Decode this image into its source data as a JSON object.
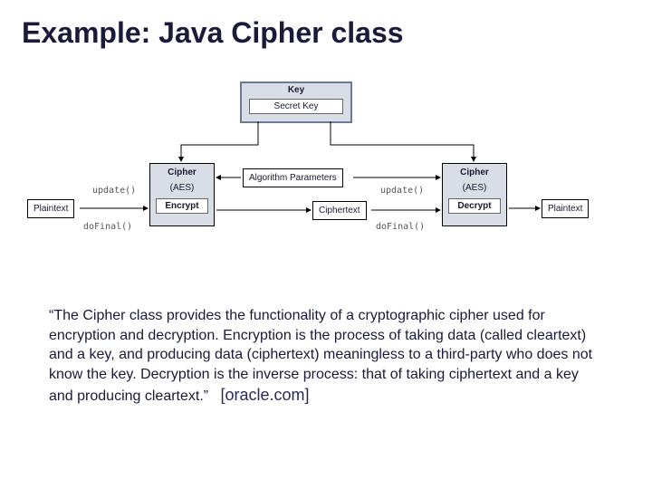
{
  "title": "Example: Java Cipher class",
  "diagram": {
    "key": {
      "label": "Key",
      "secret": "Secret Key"
    },
    "enc": {
      "plaintext": "Plaintext",
      "update": "update()",
      "doFinal": "doFinal()",
      "cipher": "Cipher",
      "aes": "(AES)",
      "encrypt": "Encrypt"
    },
    "params": "Algorithm Parameters",
    "mid": {
      "ciphertext": "Ciphertext",
      "update": "update()",
      "doFinal": "doFinal()"
    },
    "dec": {
      "cipher": "Cipher",
      "aes": "(AES)",
      "decrypt": "Decrypt",
      "plaintext": "Plaintext"
    }
  },
  "quote": {
    "text": "“The Cipher class provides the functionality of a cryptographic cipher used for encryption and decryption. Encryption is the process of taking data (called cleartext) and a key, and producing data (ciphertext) meaningless to a third-party who does not know the key. Decryption is the inverse process: that of taking ciphertext and a key and producing cleartext.”",
    "source": "[oracle.com]"
  }
}
